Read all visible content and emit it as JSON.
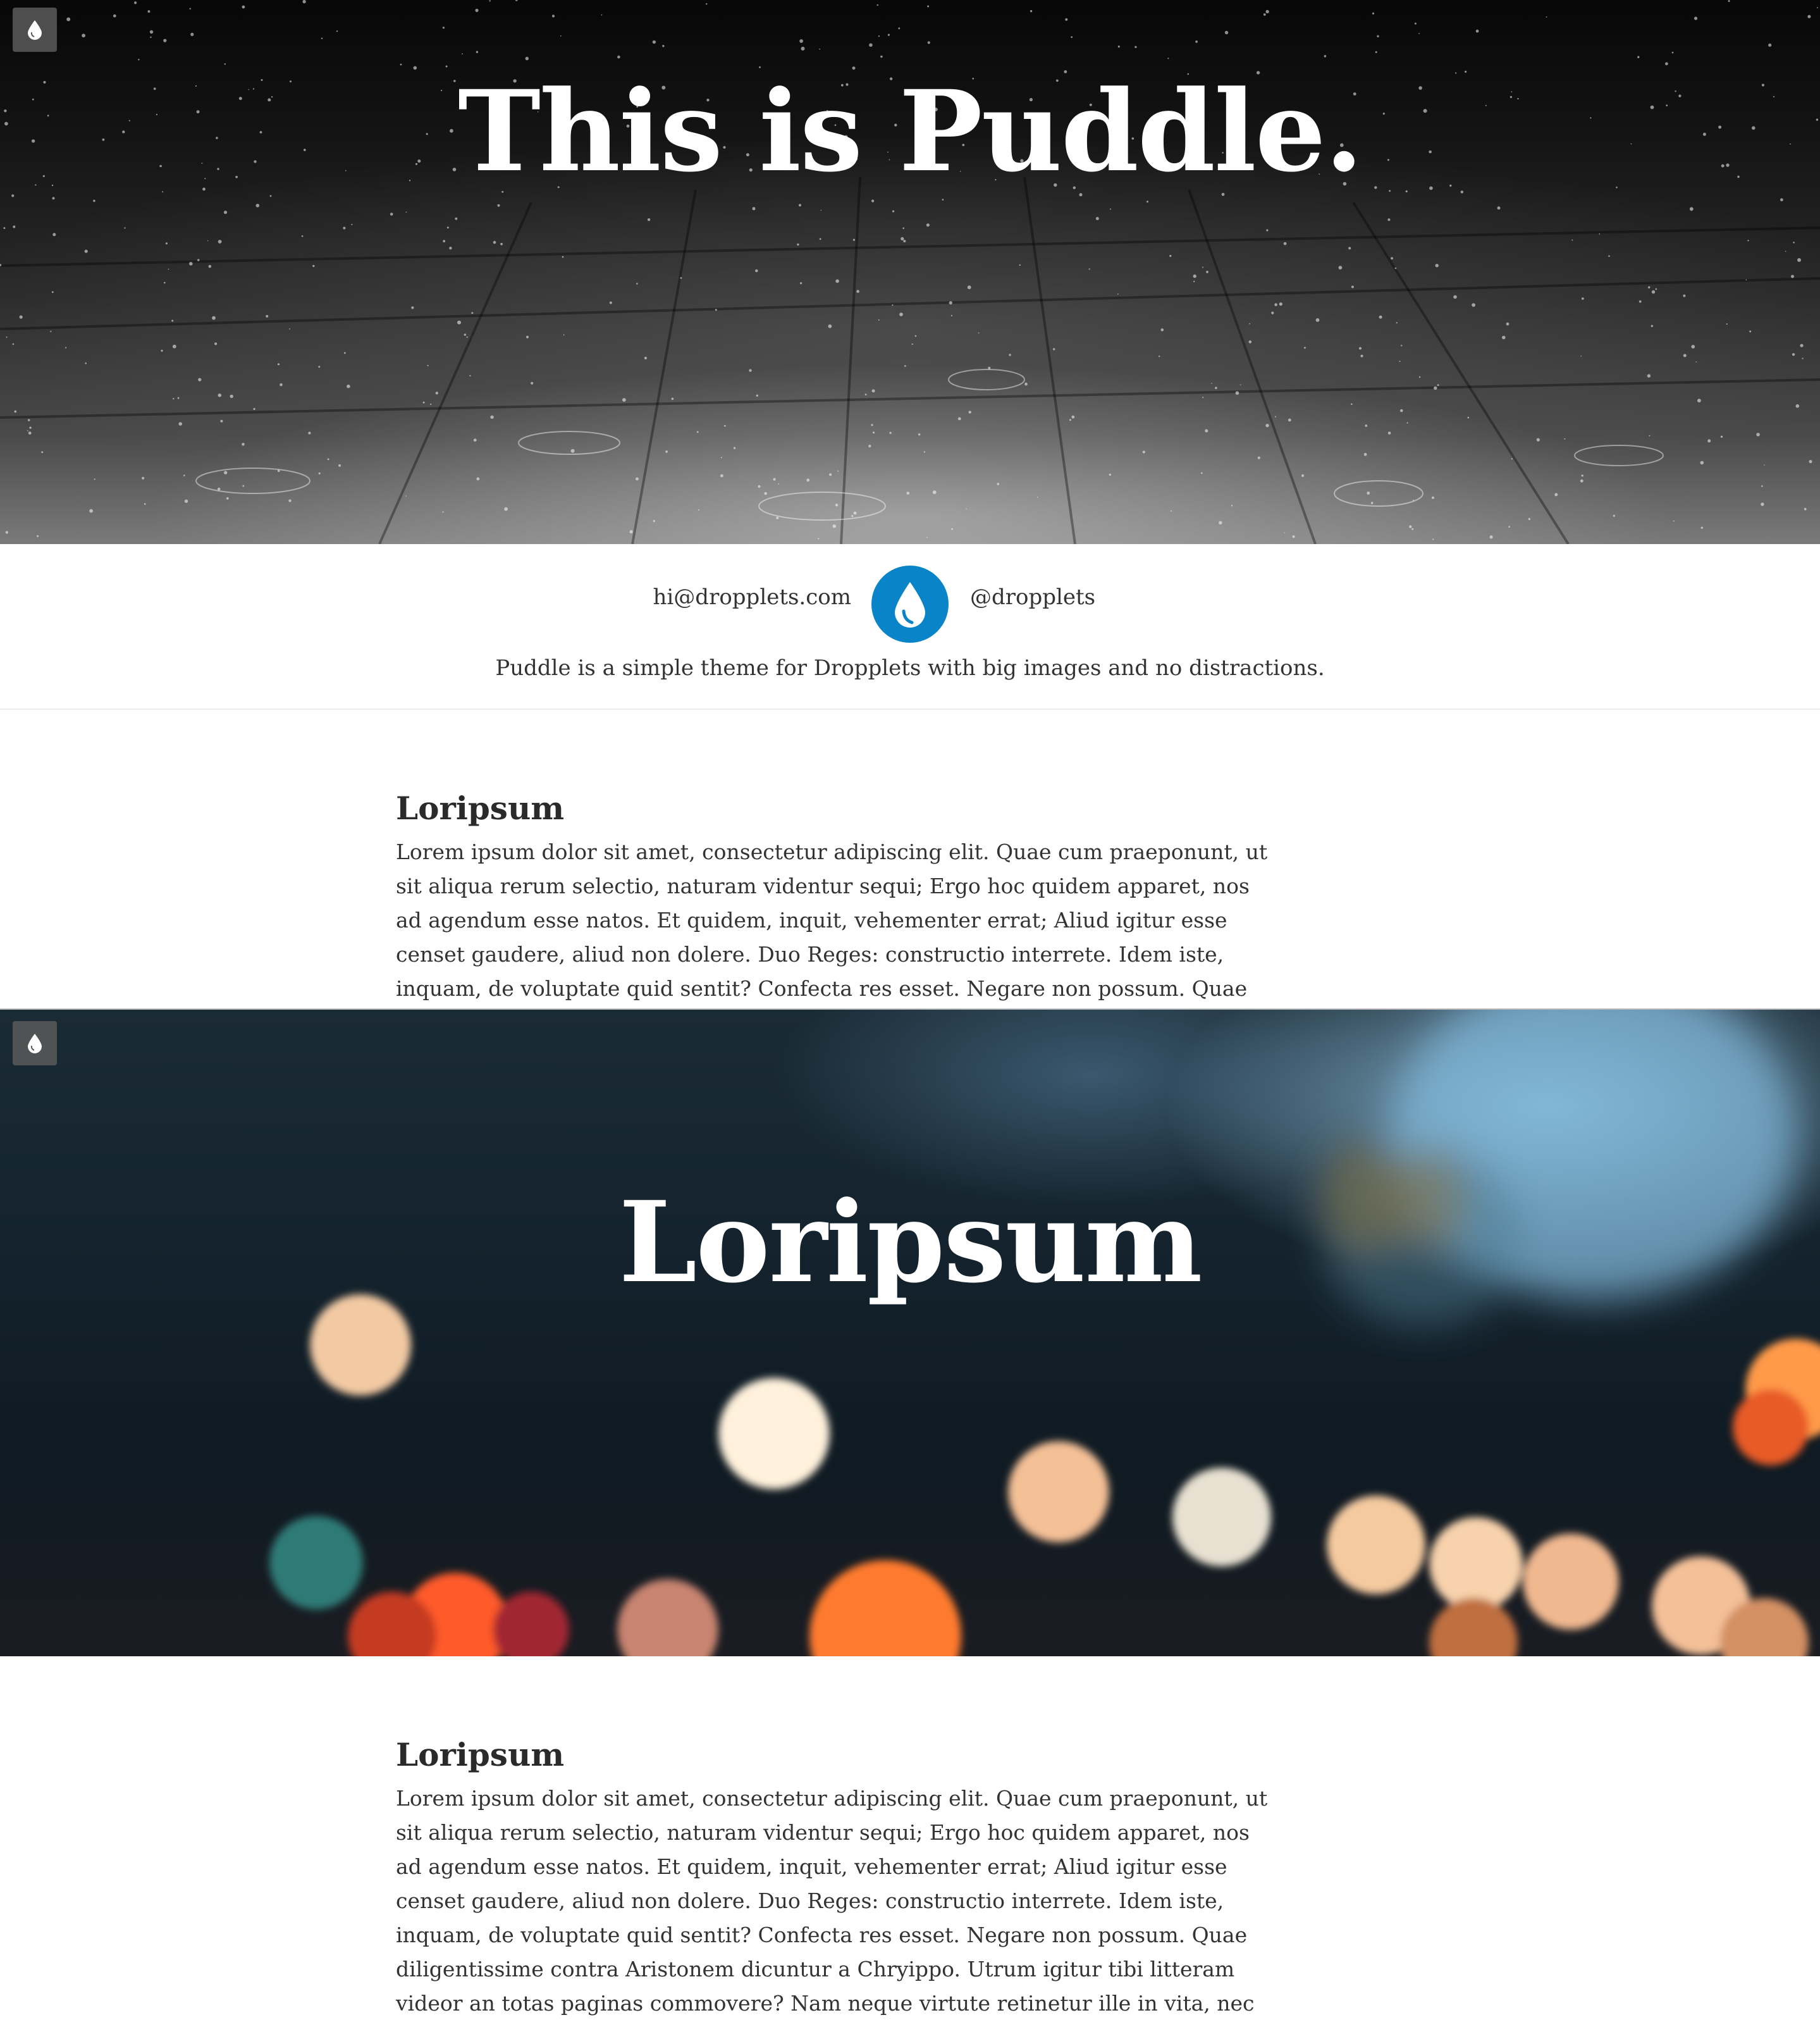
{
  "site": {
    "title": "This is Puddle.",
    "email": "hi@dropplets.com",
    "handle": "@dropplets",
    "tagline": "Puddle is a simple theme for Dropplets with big images and no distractions.",
    "logo_icon": "droplet-icon",
    "accent_color": "#0a84c8"
  },
  "menu_badge": {
    "icon": "droplet-icon"
  },
  "posts": [
    {
      "title": "Loripsum",
      "hero_title": "Loripsum",
      "body": "Lorem ipsum dolor sit amet, consectetur adipiscing elit. Quae cum praeponunt, ut sit aliqua rerum selectio, naturam videntur sequi; Ergo hoc quidem apparet, nos ad agendum esse natos. Et quidem, inquit, vehementer errat; Aliud igitur esse censet gaudere, aliud non dolere. Duo Reges: constructio interrete. Idem iste, inquam, de voluptate quid sentit? Confecta res esset. Negare non possum. Quae diligentissime"
    },
    {
      "title": "Loripsum",
      "body": "Lorem ipsum dolor sit amet, consectetur adipiscing elit. Quae cum praeponunt, ut sit aliqua rerum selectio, naturam videntur sequi; Ergo hoc quidem apparet, nos ad agendum esse natos. Et quidem, inquit, vehementer errat; Aliud igitur esse censet gaudere, aliud non dolere. Duo Reges: constructio interrete. Idem iste, inquam, de voluptate quid sentit? Confecta res esset. Negare non possum. Quae diligentissime contra Aristonem dicuntur a Chryippo. Utrum igitur tibi litteram videor an totas paginas commovere? Nam neque virtute retinetur ille in vita, nec iis, qui sine virtute"
    }
  ]
}
